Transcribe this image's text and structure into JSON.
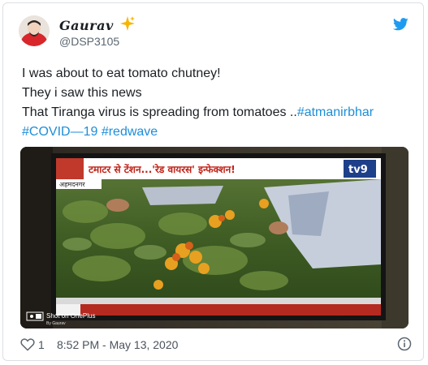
{
  "author": {
    "display_name": "Gaurav",
    "sparkle_emoji": "✨",
    "handle": "@DSP3105"
  },
  "tweet": {
    "line1": "I was about to eat tomato chutney!",
    "line2": "They i saw this news",
    "line3_text": "That Tiranga virus is spreading from tomatoes ..",
    "line3_link": "#atmanirbhar",
    "line4_link1": "#COVID—19",
    "line4_link2": "#redwave"
  },
  "media": {
    "headline": "टमाटर से टेंशन...'रेड वायरस' इन्फेक्शन!",
    "channel_logo": "tv9",
    "location_tag": "अहमदनगर",
    "camera_watermark": "Shot on OnePlus",
    "camera_watermark_sub": "By Gaurav"
  },
  "footer": {
    "likes": "1",
    "timestamp": "8:52 PM - May 13, 2020"
  },
  "colors": {
    "link": "#1d8ed8",
    "twitter_blue": "#1d9bf0",
    "heart_outline": "#5b6670"
  }
}
